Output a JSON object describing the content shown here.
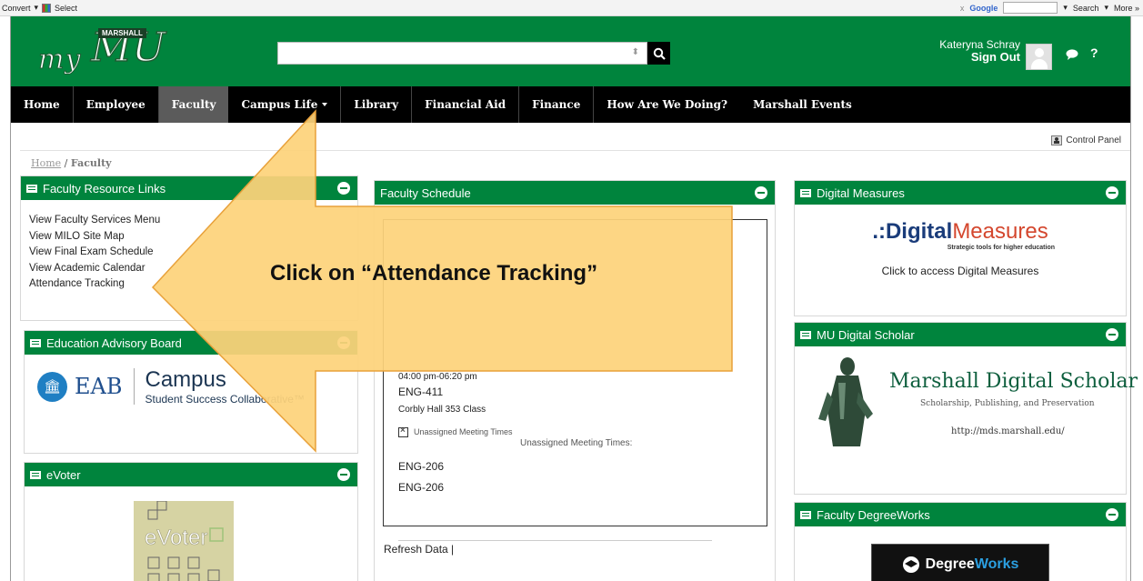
{
  "browser": {
    "convert_label": "Convert",
    "select_label": "Select",
    "google_label": "Google",
    "search_label": "Search",
    "more_label": "More »",
    "close_label": "x"
  },
  "header": {
    "logo_text_my": "my",
    "logo_text_mu": "MU",
    "logo_badge": "MARSHALL",
    "search_placeholder": "",
    "user_name": "Kateryna Schray",
    "sign_out": "Sign Out"
  },
  "nav": {
    "items": [
      {
        "label": "Home"
      },
      {
        "label": "Employee"
      },
      {
        "label": "Faculty"
      },
      {
        "label": "Campus Life"
      },
      {
        "label": "Library"
      },
      {
        "label": "Financial Aid"
      },
      {
        "label": "Finance"
      },
      {
        "label": "How Are We Doing?"
      },
      {
        "label": "Marshall Events"
      }
    ]
  },
  "control_panel": "Control Panel",
  "breadcrumb": {
    "home": "Home",
    "sep": " / ",
    "current": "Faculty"
  },
  "portlets": {
    "faculty_links": {
      "title": "Faculty Resource Links",
      "links": [
        "View Faculty Services Menu",
        "View MILO Site Map",
        "View Final Exam Schedule",
        "View Academic Calendar",
        "Attendance Tracking"
      ]
    },
    "eab": {
      "title": "Education Advisory Board",
      "logo_eab": "EAB",
      "logo_campus": "Campus",
      "logo_sub": "Student Success Collaborative™"
    },
    "evoter": {
      "title": "eVoter",
      "logo_text": "eVoter"
    },
    "schedule": {
      "title": "Faculty Schedule",
      "time": "04:00 pm-06:20 pm",
      "course": "ENG-411",
      "location": "Corbly Hall 353 Class",
      "unassigned_label": "Unassigned Meeting Times",
      "unassigned_heading": "Unassigned Meeting Times:",
      "courses_unassigned": [
        "ENG-206",
        "ENG-206"
      ],
      "refresh": "Refresh Data |"
    },
    "digital_measures": {
      "title": "Digital Measures",
      "logo_a": ".:Digital",
      "logo_b": "Measures",
      "tagline": "Strategic tools for higher education",
      "link": "Click to access Digital Measures"
    },
    "digital_scholar": {
      "title": "MU Digital Scholar",
      "logo_title": "Marshall Digital Scholar",
      "logo_sub": "Scholarship, Publishing, and Preservation",
      "url": "http://mds.marshall.edu/"
    },
    "degreeworks": {
      "title": "Faculty DegreeWorks",
      "logo_a": "Degree",
      "logo_b": "Works"
    }
  },
  "callout": {
    "text": "Click on “Attendance Tracking”"
  },
  "colors": {
    "brand_green": "#00843d",
    "nav_black": "#000000",
    "active_gray": "#5b5b5b",
    "callout_fill": "#fdd37b",
    "callout_stroke": "#e8a13a"
  }
}
